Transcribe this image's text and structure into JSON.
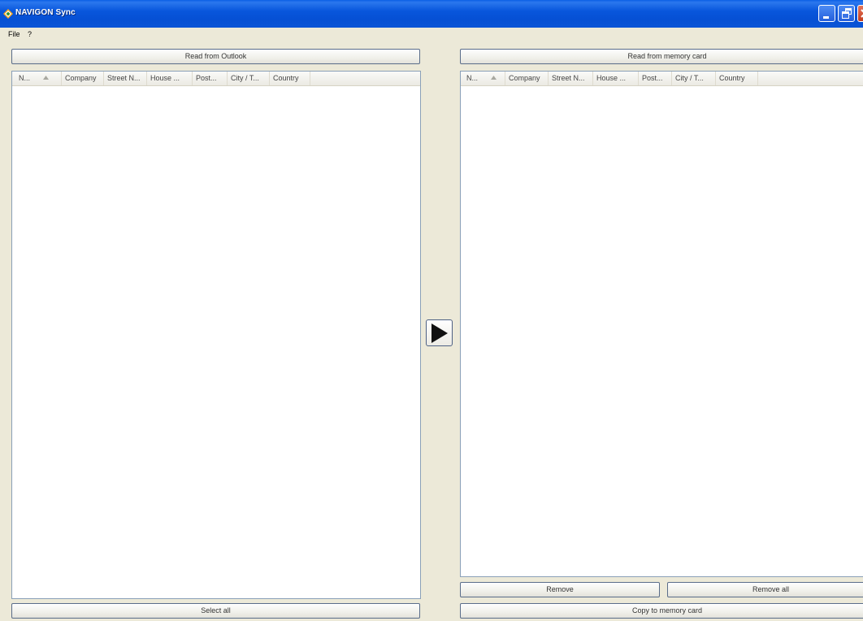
{
  "window": {
    "title": "NAVIGON Sync"
  },
  "menu": {
    "items": [
      "File",
      "?"
    ]
  },
  "left_panel": {
    "read_button": "Read from Outlook",
    "columns": [
      "N...",
      "Company",
      "Street N...",
      "House ...",
      "Post...",
      "City / T...",
      "Country"
    ],
    "sort_indicator": "^",
    "select_all_button": "Select all"
  },
  "transfer": {
    "icon": "play-arrow-icon"
  },
  "right_panel": {
    "read_button": "Read from memory card",
    "columns": [
      "N...",
      "Company",
      "Street N...",
      "House ...",
      "Post...",
      "City / T...",
      "Country"
    ],
    "sort_indicator": "^",
    "remove_button": "Remove",
    "remove_all_button": "Remove all",
    "copy_button": "Copy to memory card"
  },
  "colors": {
    "titlebar": "#0a5fe6",
    "background": "#ece9d8",
    "close_button": "#c33c1e"
  }
}
